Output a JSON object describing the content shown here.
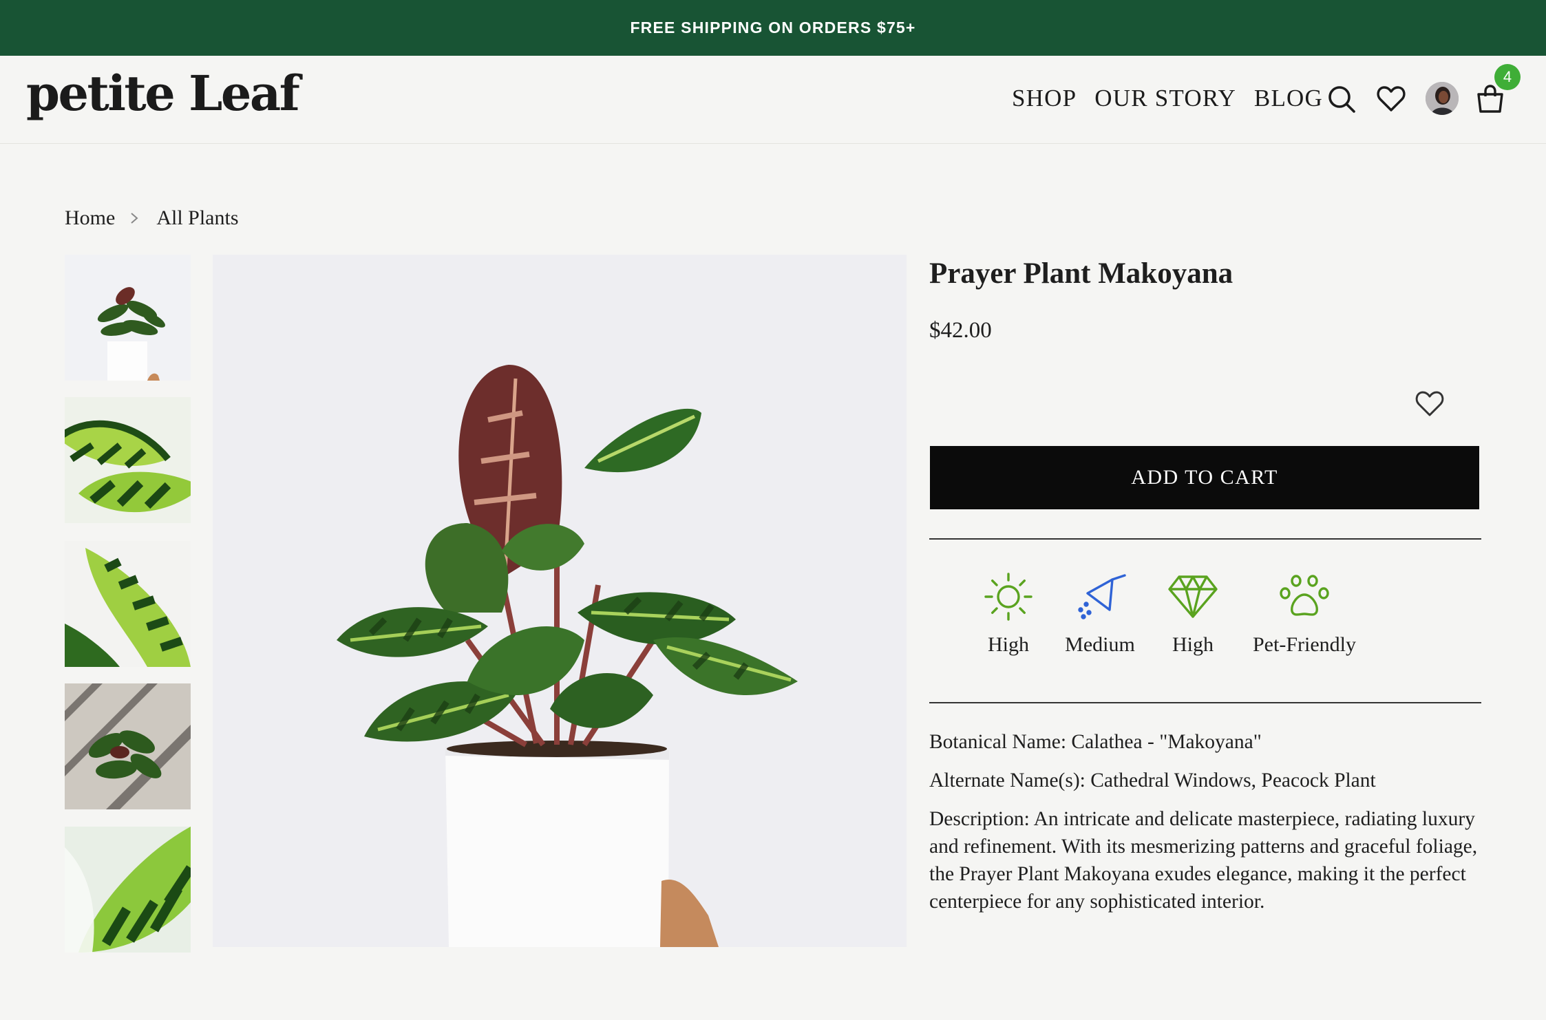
{
  "promo": {
    "text": "FREE SHIPPING ON ORDERS $75+"
  },
  "header": {
    "logo": "petite Leaf",
    "nav": [
      "SHOP",
      "OUR STORY",
      "BLOG"
    ],
    "cart_count": "4",
    "icons": [
      "search-icon",
      "heart-icon",
      "avatar",
      "shopping-bag-icon"
    ]
  },
  "breadcrumb": {
    "items": [
      "Home",
      "All Plants"
    ],
    "separator_icon": "chevron-right-icon"
  },
  "gallery": {
    "thumbnails": [
      "plant-full-view",
      "leaf-closeup-1",
      "leaf-closeup-2",
      "plant-top-view-shadow",
      "leaf-closeup-3"
    ],
    "main_image": "prayer-plant-makoyana-in-white-pot"
  },
  "product": {
    "title": "Prayer Plant Makoyana",
    "price": "$42.00",
    "add_to_cart": "ADD TO CART",
    "care": [
      {
        "icon": "sun-icon",
        "label": "High",
        "color": "#5aa31f"
      },
      {
        "icon": "watering-can-icon",
        "label": "Medium",
        "color": "#2f63d6"
      },
      {
        "icon": "diamond-icon",
        "label": "High",
        "color": "#5aa31f"
      },
      {
        "icon": "paw-icon",
        "label": "Pet-Friendly",
        "color": "#5aa31f"
      }
    ],
    "botanical": "Botanical Name: Calathea - \"Makoyana\"",
    "alternate": "Alternate Name(s): Cathedral Windows, Peacock Plant",
    "description": "Description: An intricate and delicate masterpiece, radiating luxury and refinement. With its mesmerizing patterns and graceful foliage, the Prayer Plant Makoyana exudes elegance, making it the perfect centerpiece for any sophisticated interior."
  },
  "colors": {
    "promo_bg": "#185434",
    "badge": "#3fae37",
    "button": "#0b0b0b",
    "page_bg": "#f5f5f3"
  }
}
